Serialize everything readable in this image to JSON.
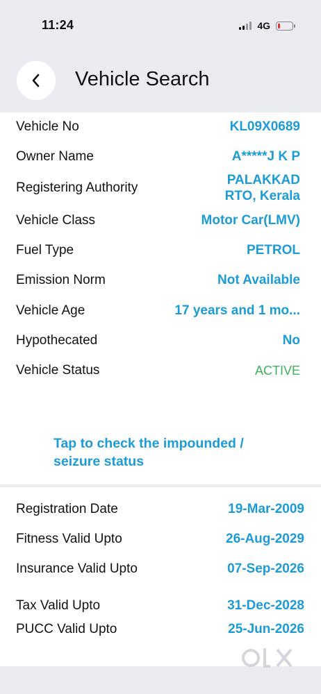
{
  "status_bar": {
    "time": "11:24",
    "network": "4G",
    "battery_level": 0.15,
    "battery_color": "#e5322d"
  },
  "header": {
    "title": "Vehicle Search",
    "back_icon": "chevron-left-icon"
  },
  "vehicle_details": [
    {
      "label": "Vehicle No",
      "value": "KL09X0689"
    },
    {
      "label": "Owner Name",
      "value": "A*****J K P"
    },
    {
      "label": "Registering Authority",
      "value_line1": "PALAKKAD",
      "value_line2": "RTO, Kerala"
    },
    {
      "label": "Vehicle Class",
      "value": "Motor Car(LMV)"
    },
    {
      "label": "Fuel Type",
      "value": "PETROL"
    },
    {
      "label": "Emission Norm",
      "value": "Not Available"
    },
    {
      "label": "Vehicle Age",
      "value": "17 years and 1 mo..."
    },
    {
      "label": "Hypothecated",
      "value": "No"
    },
    {
      "label": "Vehicle Status",
      "value": "ACTIVE"
    }
  ],
  "impound_link": {
    "line1": "Tap to check the impounded /",
    "line2": "seizure status"
  },
  "validity_dates": [
    {
      "label": "Registration Date",
      "value": "19-Mar-2009"
    },
    {
      "label": "Fitness Valid Upto",
      "value": "26-Aug-2029"
    },
    {
      "label": "Insurance Valid Upto",
      "value": "07-Sep-2026"
    },
    {
      "label": "Tax Valid Upto",
      "value": "31-Dec-2028"
    },
    {
      "label": "PUCC Valid Upto",
      "value": "25-Jun-2026"
    }
  ],
  "colors": {
    "accent": "#1d9bd6",
    "status_active": "#3bb15a",
    "background": "#eaecf1"
  },
  "watermark": {
    "logo_text": "OLX",
    "icon": "olx-logo-icon"
  }
}
